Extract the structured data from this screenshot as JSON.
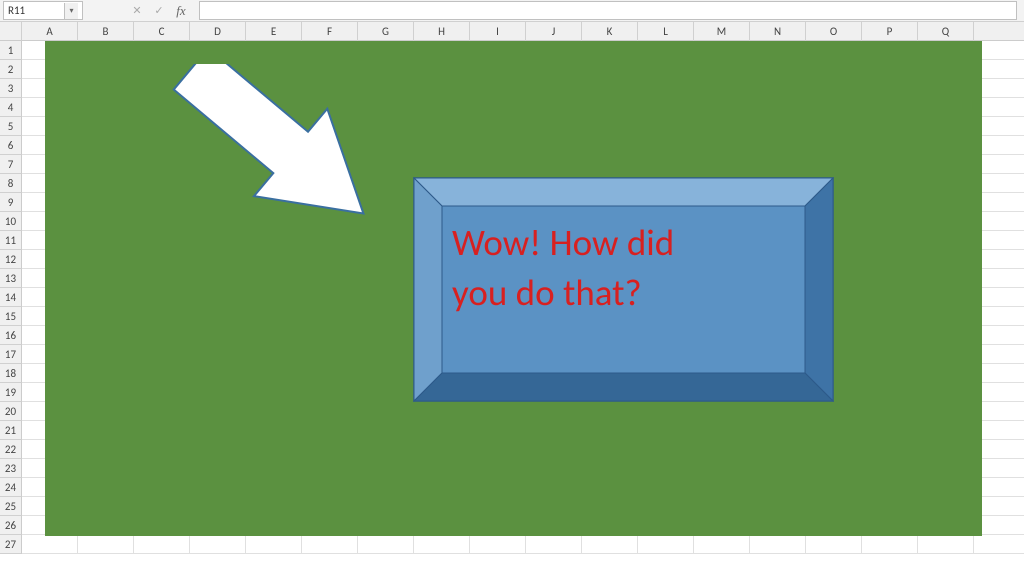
{
  "formula_bar": {
    "name_box_value": "R11",
    "cancel_symbol": "✕",
    "enter_symbol": "✓",
    "fx_label": "fx",
    "formula_value": ""
  },
  "columns": [
    "A",
    "B",
    "C",
    "D",
    "E",
    "F",
    "G",
    "H",
    "I",
    "J",
    "K",
    "L",
    "M",
    "N",
    "O",
    "P",
    "Q"
  ],
  "rows": [
    "1",
    "2",
    "3",
    "4",
    "5",
    "6",
    "7",
    "8",
    "9",
    "10",
    "11",
    "12",
    "13",
    "14",
    "15",
    "16",
    "17",
    "18",
    "19",
    "20",
    "21",
    "22",
    "23",
    "24",
    "25",
    "26",
    "27"
  ],
  "shapes": {
    "green_fill_color": "#5b9140",
    "arrow": {
      "fill": "#ffffff",
      "stroke": "#3a6fa0"
    },
    "bevel": {
      "fill_top": "#7aa8d0",
      "fill_mid": "#5b92c4",
      "fill_dark": "#3d6fa0",
      "stroke": "#2d5a8a",
      "text_line1": "Wow! How did",
      "text_line2": "you do that?",
      "text_color": "#d82020"
    }
  },
  "active_cell": "R11"
}
